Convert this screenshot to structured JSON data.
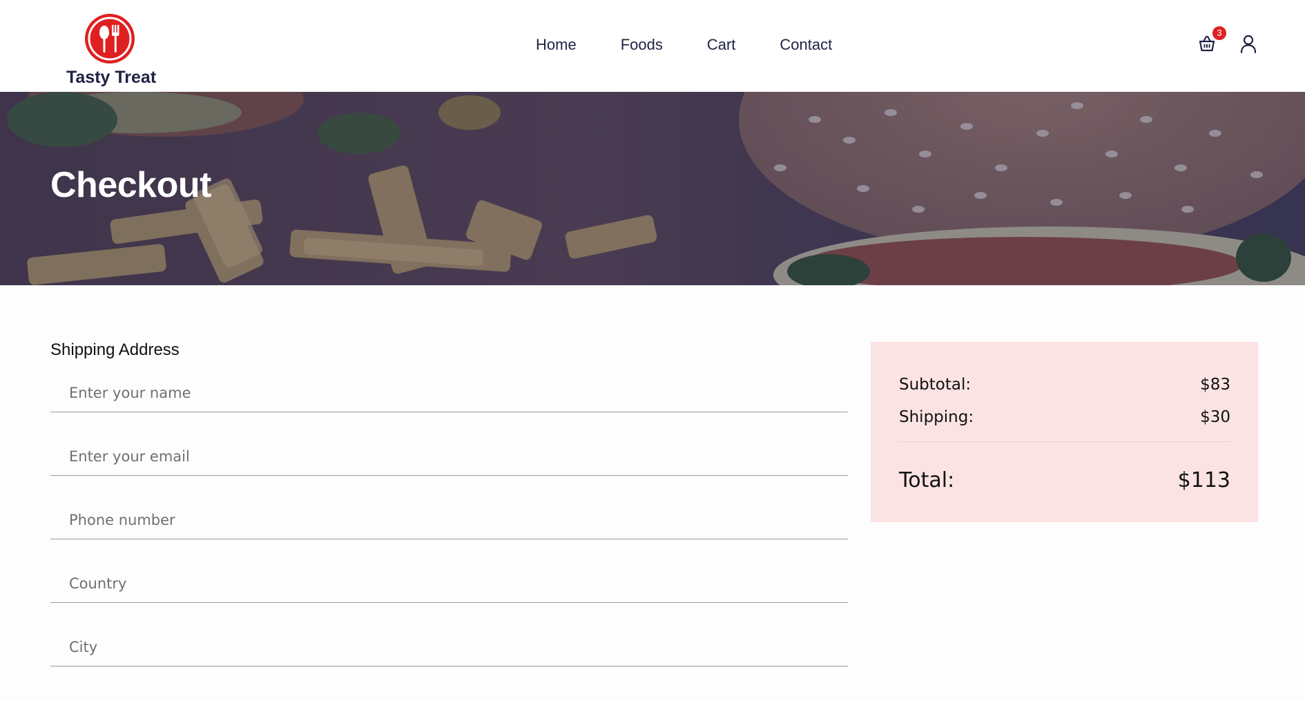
{
  "brand": {
    "name": "Tasty Treat",
    "accent": "#df2020",
    "text_color": "#212245"
  },
  "nav": {
    "items": [
      {
        "label": "Home"
      },
      {
        "label": "Foods"
      },
      {
        "label": "Cart"
      },
      {
        "label": "Contact"
      }
    ]
  },
  "header_actions": {
    "cart_count": "3",
    "cart_icon": "shopping-basket-icon",
    "user_icon": "user-icon"
  },
  "hero": {
    "title": "Checkout"
  },
  "shipping_form": {
    "heading": "Shipping Address",
    "fields": {
      "name": {
        "placeholder": "Enter your name",
        "value": ""
      },
      "email": {
        "placeholder": "Enter your email",
        "value": ""
      },
      "phone": {
        "placeholder": "Phone number",
        "value": ""
      },
      "country": {
        "placeholder": "Country",
        "value": ""
      },
      "city": {
        "placeholder": "City",
        "value": ""
      }
    }
  },
  "order_summary": {
    "background": "#fbe3e3",
    "subtotal_label": "Subtotal:",
    "subtotal_value": "$83",
    "shipping_label": "Shipping:",
    "shipping_value": "$30",
    "total_label": "Total:",
    "total_value": "$113"
  }
}
